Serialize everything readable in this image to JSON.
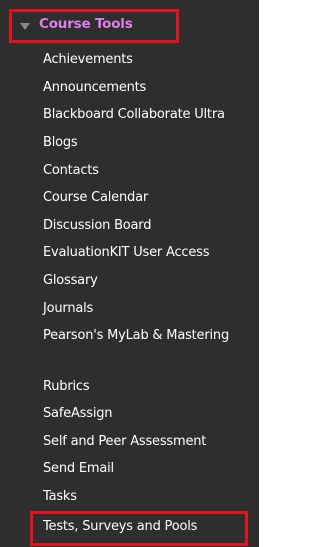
{
  "section": {
    "title": "Course Tools",
    "expand_icon": "triangle-down-icon",
    "highlight_color": "#e0141e",
    "title_color": "#e07ee8"
  },
  "items": [
    "Achievements",
    "Announcements",
    "Blackboard Collaborate Ultra",
    "Blogs",
    "Contacts",
    "Course Calendar",
    "Discussion Board",
    "EvaluationKIT User Access",
    "Glossary",
    "Journals",
    "Pearson's MyLab & Mastering",
    "Rubrics",
    "SafeAssign",
    "Self and Peer Assessment",
    "Send Email",
    "Tasks",
    "Tests, Surveys and Pools"
  ]
}
